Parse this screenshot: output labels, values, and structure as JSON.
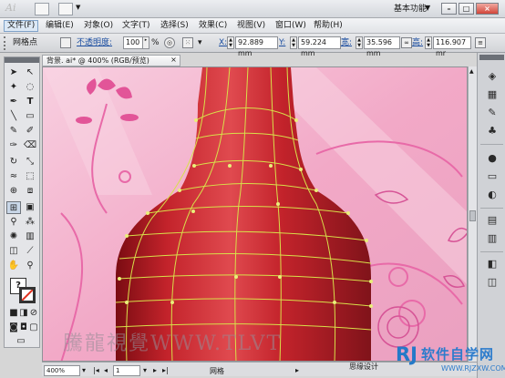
{
  "app": {
    "logo": "Ai",
    "workspace": "基本功能",
    "window_buttons": [
      "–",
      "□",
      "×"
    ]
  },
  "menu": [
    "文件(F)",
    "编辑(E)",
    "对象(O)",
    "文字(T)",
    "选择(S)",
    "效果(C)",
    "视图(V)",
    "窗口(W)",
    "帮助(H)"
  ],
  "control": {
    "selection_label": "网格点",
    "opacity_label": "不透明度:",
    "opacity_value": "100",
    "opacity_unit": "%",
    "x_label": "X:",
    "x_value": "92.889 mm",
    "y_label": "Y:",
    "y_value": "59.224 mm",
    "w_label": "宽:",
    "w_value": "35.596 mm",
    "h_label": "高:",
    "h_value": "116.907 mr"
  },
  "document": {
    "tab_title": "背景. ai* @ 400% (RGB/预览)",
    "close": "×",
    "zoom": "400%",
    "page": "1",
    "status_text": "网格"
  },
  "canvas": {
    "watermark_text": "騰龍視覺WWW.TLV",
    "watermark_suffix": "T",
    "designer": "思缘设计",
    "colors": {
      "background": "#f2b8cf",
      "bottle_red": "#c8262e",
      "mesh_line": "#d8e04a",
      "pink_decor": "#e86aa8"
    }
  },
  "logo": {
    "glyph": "RJ",
    "name": "软件自学网",
    "url": "WWW.RJZXW.COM"
  }
}
